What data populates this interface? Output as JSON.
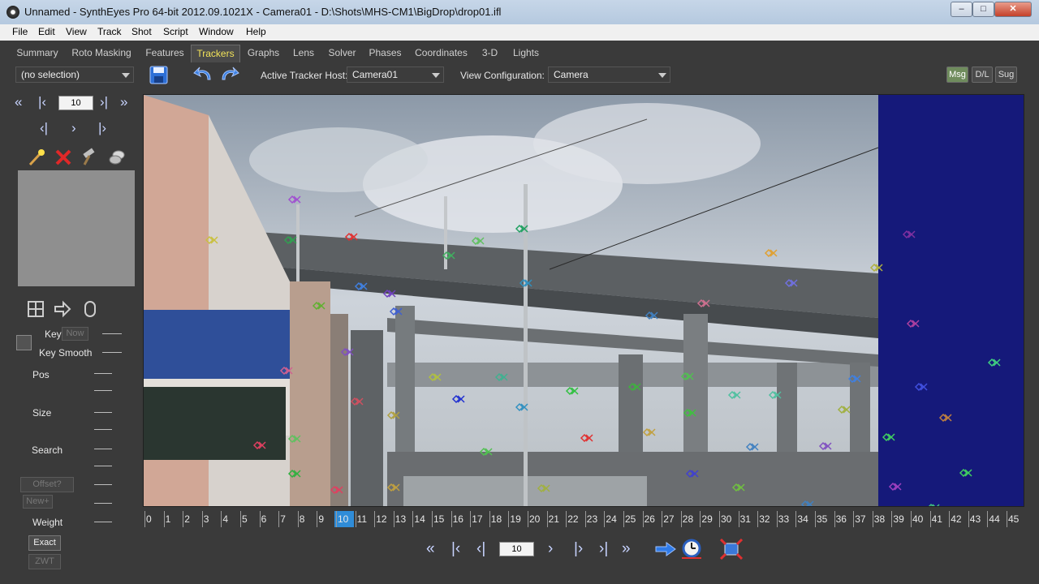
{
  "window": {
    "title": "Unnamed - SynthEyes Pro 64-bit 2012.09.1021X - Camera01 - D:\\Shots\\MHS-CM1\\BigDrop\\drop01.ifl",
    "minimize": "–",
    "maximize": "□",
    "close": "✕"
  },
  "menu": [
    "File",
    "Edit",
    "View",
    "Track",
    "Shot",
    "Script",
    "Window",
    "Help"
  ],
  "tabs": [
    "Summary",
    "Roto Masking",
    "Features",
    "Trackers",
    "Graphs",
    "Lens",
    "Solver",
    "Phases",
    "Coordinates",
    "3-D",
    "Lights"
  ],
  "active_tab": "Trackers",
  "toolbar": {
    "selection_value": "(no selection)",
    "active_tracker_host_label": "Active Tracker Host:",
    "active_tracker_host_value": "Camera01",
    "view_configuration_label": "View Configuration:",
    "view_configuration_value": "Camera",
    "msg": "Msg",
    "dl": "D/L",
    "sug": "Sug"
  },
  "left_panel": {
    "frame": "10",
    "key_label": "Key",
    "now_label": "Now",
    "key_smooth_label": "Key Smooth",
    "pos_label": "Pos",
    "size_label": "Size",
    "search_label": "Search",
    "offset_label": "Offset?",
    "new_label": "New+",
    "weight_label": "Weight",
    "exact_label": "Exact",
    "zwt_label": "ZWT"
  },
  "timeline": {
    "frames": [
      "0",
      "1",
      "2",
      "3",
      "4",
      "5",
      "6",
      "7",
      "8",
      "9",
      "10",
      "11",
      "12",
      "13",
      "14",
      "15",
      "16",
      "17",
      "18",
      "19",
      "20",
      "21",
      "22",
      "23",
      "24",
      "25",
      "26",
      "27",
      "28",
      "29",
      "30",
      "31",
      "32",
      "33",
      "34",
      "35",
      "36",
      "37",
      "38",
      "39",
      "40",
      "41",
      "42",
      "43",
      "44",
      "45"
    ],
    "current_frame": "10"
  },
  "bottom_controls": {
    "frame": "10"
  },
  "colors": {
    "accent_tab": "#f2e35a",
    "current_frame": "#2f8cd8",
    "blue_field": "#15197a"
  },
  "icons": [
    "rewind-start-icon",
    "step-back-icon",
    "step-forward-icon",
    "fast-forward-end-icon",
    "wand-icon",
    "delete-icon",
    "hammer-icon",
    "lock-icon",
    "layout-icon",
    "arrow-right-icon",
    "mouse-icon",
    "save-icon",
    "undo-icon",
    "redo-icon",
    "go-arrow-icon",
    "clock-icon",
    "fit-view-icon"
  ]
}
